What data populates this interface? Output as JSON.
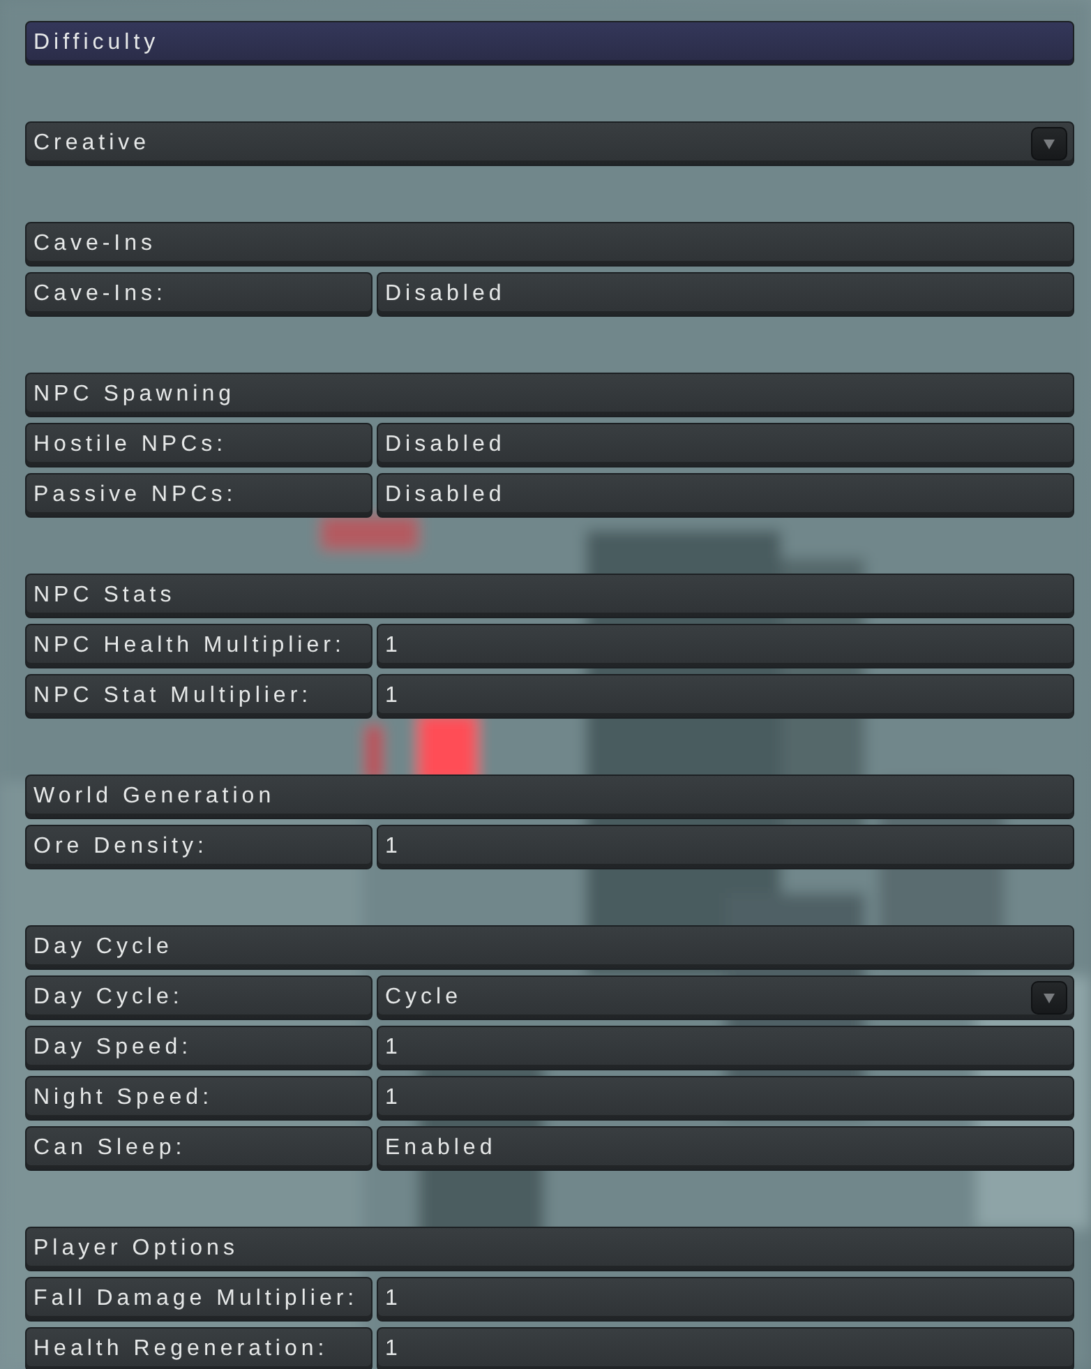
{
  "title_bar": {
    "text": "Difficulty"
  },
  "difficulty_select": {
    "value": "Creative"
  },
  "sections": [
    {
      "title": "Cave-Ins",
      "rows": [
        {
          "label": "Cave-Ins:",
          "value": "Disabled",
          "kind": "text"
        }
      ]
    },
    {
      "title": "NPC Spawning",
      "rows": [
        {
          "label": "Hostile NPCs:",
          "value": "Disabled",
          "kind": "text"
        },
        {
          "label": "Passive NPCs:",
          "value": "Disabled",
          "kind": "text"
        }
      ]
    },
    {
      "title": "NPC Stats",
      "rows": [
        {
          "label": "NPC Health Multiplier:",
          "value": "1",
          "kind": "text"
        },
        {
          "label": "NPC Stat Multiplier:",
          "value": "1",
          "kind": "text"
        }
      ]
    },
    {
      "title": "World Generation",
      "rows": [
        {
          "label": "Ore Density:",
          "value": "1",
          "kind": "text"
        }
      ]
    },
    {
      "title": "Day Cycle",
      "rows": [
        {
          "label": "Day Cycle:",
          "value": "Cycle",
          "kind": "dropdown"
        },
        {
          "label": "Day Speed:",
          "value": "1",
          "kind": "text"
        },
        {
          "label": "Night Speed:",
          "value": "1",
          "kind": "text"
        },
        {
          "label": "Can Sleep:",
          "value": "Enabled",
          "kind": "text"
        }
      ]
    },
    {
      "title": "Player Options",
      "rows": [
        {
          "label": "Fall Damage Multiplier:",
          "value": "1",
          "kind": "text"
        },
        {
          "label": "Health Regeneration:",
          "value": "1",
          "kind": "text"
        }
      ]
    }
  ]
}
